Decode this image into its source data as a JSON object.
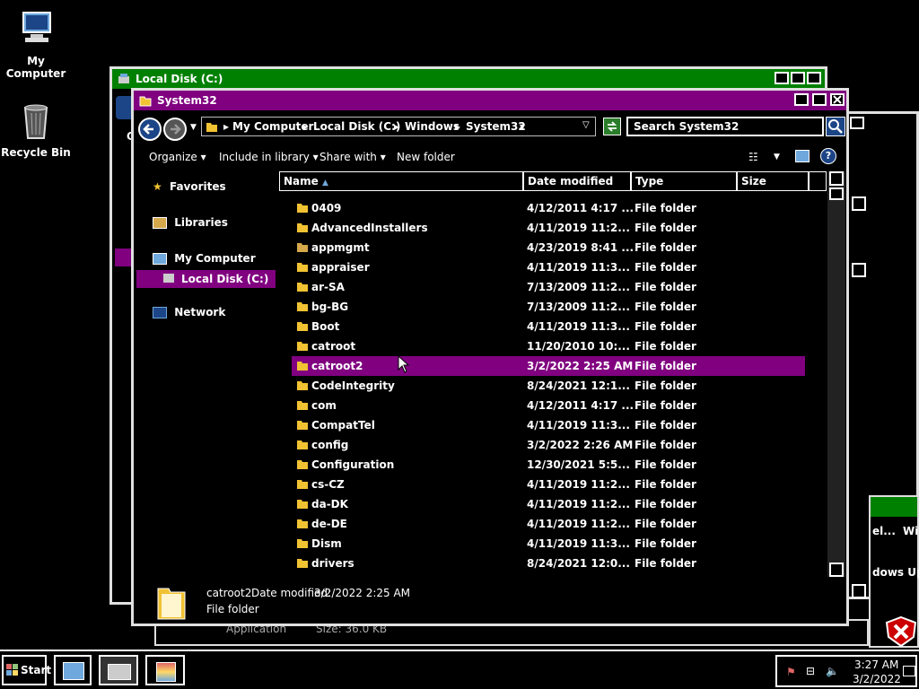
{
  "desktop": {
    "icons": [
      {
        "label": "My Computer",
        "icon": "computer-icon"
      },
      {
        "label": "Recycle Bin",
        "icon": "recycle-bin-icon"
      }
    ]
  },
  "colors": {
    "accent_purple": "#800080",
    "accent_green": "#008000",
    "background": "#000000"
  },
  "back_window": {
    "title": "Local Disk (C:)",
    "partial_left_letter": "O",
    "partial_breadcrumb": "el...",
    "partial_breadcrumb2": "Wir",
    "partial_text": "dows Upd",
    "details_type": "Application",
    "details_size": "Size: 36.0 KB"
  },
  "window": {
    "title": "System32",
    "breadcrumbs": [
      "My Computer",
      "Local Disk (C:)",
      "Windows",
      "System32"
    ],
    "search_placeholder": "Search System32",
    "toolbar": {
      "organize": "Organize",
      "include_in_library": "Include in library",
      "share_with": "Share with",
      "new_folder": "New folder"
    },
    "nav": {
      "favorites": "Favorites",
      "libraries": "Libraries",
      "my_computer": "My Computer",
      "local_disk": "Local Disk (C:)",
      "network": "Network"
    },
    "columns": {
      "name": "Name",
      "date": "Date modified",
      "type": "Type",
      "size": "Size"
    },
    "rows": [
      {
        "name": "0409",
        "date": "4/12/2011 4:17 ...",
        "type": "File folder"
      },
      {
        "name": "AdvancedInstallers",
        "date": "4/11/2019 11:2...",
        "type": "File folder"
      },
      {
        "name": "appmgmt",
        "date": "4/23/2019 8:41 ...",
        "type": "File folder"
      },
      {
        "name": "appraiser",
        "date": "4/11/2019 11:3...",
        "type": "File folder"
      },
      {
        "name": "ar-SA",
        "date": "7/13/2009 11:2...",
        "type": "File folder"
      },
      {
        "name": "bg-BG",
        "date": "7/13/2009 11:2...",
        "type": "File folder"
      },
      {
        "name": "Boot",
        "date": "4/11/2019 11:3...",
        "type": "File folder"
      },
      {
        "name": "catroot",
        "date": "11/20/2010 10:...",
        "type": "File folder"
      },
      {
        "name": "catroot2",
        "date": "3/2/2022 2:25 AM",
        "type": "File folder"
      },
      {
        "name": "CodeIntegrity",
        "date": "8/24/2021 12:1...",
        "type": "File folder"
      },
      {
        "name": "com",
        "date": "4/12/2011 4:17 ...",
        "type": "File folder"
      },
      {
        "name": "CompatTel",
        "date": "4/11/2019 11:3...",
        "type": "File folder"
      },
      {
        "name": "config",
        "date": "3/2/2022 2:26 AM",
        "type": "File folder"
      },
      {
        "name": "Configuration",
        "date": "12/30/2021 5:5...",
        "type": "File folder"
      },
      {
        "name": "cs-CZ",
        "date": "4/11/2019 11:2...",
        "type": "File folder"
      },
      {
        "name": "da-DK",
        "date": "4/11/2019 11:2...",
        "type": "File folder"
      },
      {
        "name": "de-DE",
        "date": "4/11/2019 11:2...",
        "type": "File folder"
      },
      {
        "name": "Dism",
        "date": "4/11/2019 11:3...",
        "type": "File folder"
      },
      {
        "name": "drivers",
        "date": "8/24/2021 12:0...",
        "type": "File folder"
      }
    ],
    "selected_index": 8,
    "details": {
      "name": "catroot2",
      "date_label": "Date modified:",
      "date_value": "3/2/2022 2:25 AM",
      "type": "File folder"
    }
  },
  "taskbar": {
    "start": "Start",
    "clock_time": "3:27 AM",
    "clock_date": "3/2/2022"
  }
}
